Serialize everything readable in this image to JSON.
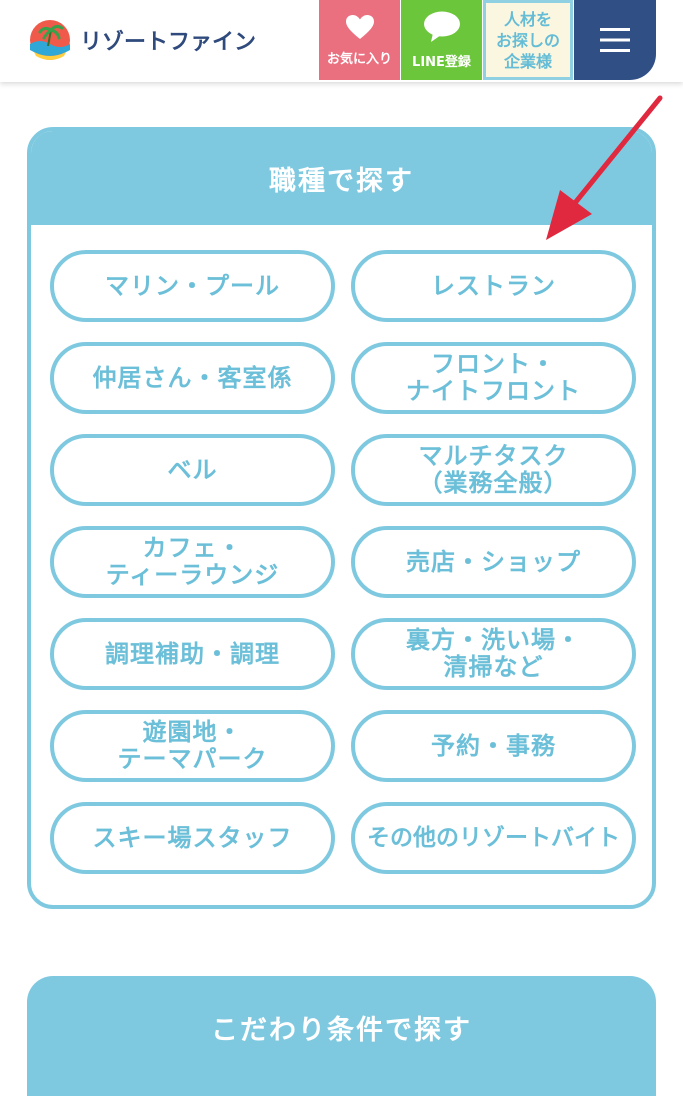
{
  "header": {
    "logo_text": "リゾートファイン",
    "favorites_label": "お気に入り",
    "line_label": "LINE登録",
    "corporate_lines": [
      "人材を",
      "お探しの",
      "企業様"
    ]
  },
  "job_section": {
    "title": "職種で探す",
    "items": [
      "マリン・プール",
      "レストラン",
      "仲居さん・客室係",
      "フロント・\nナイトフロント",
      "ベル",
      "マルチタスク\n（業務全般）",
      "カフェ・\nティーラウンジ",
      "売店・ショップ",
      "調理補助・調理",
      "裏方・洗い場・\n清掃など",
      "遊園地・\nテーマパーク",
      "予約・事務",
      "スキー場スタッフ",
      "その他のリゾートバイト"
    ]
  },
  "conditions_section": {
    "title": "こだわり条件で探す"
  },
  "colors": {
    "accent": "#7fc9e0",
    "navy": "#2f4f85",
    "favorites": "#ea6f7f",
    "line": "#6cc63b",
    "arrow": "#e0283e"
  }
}
